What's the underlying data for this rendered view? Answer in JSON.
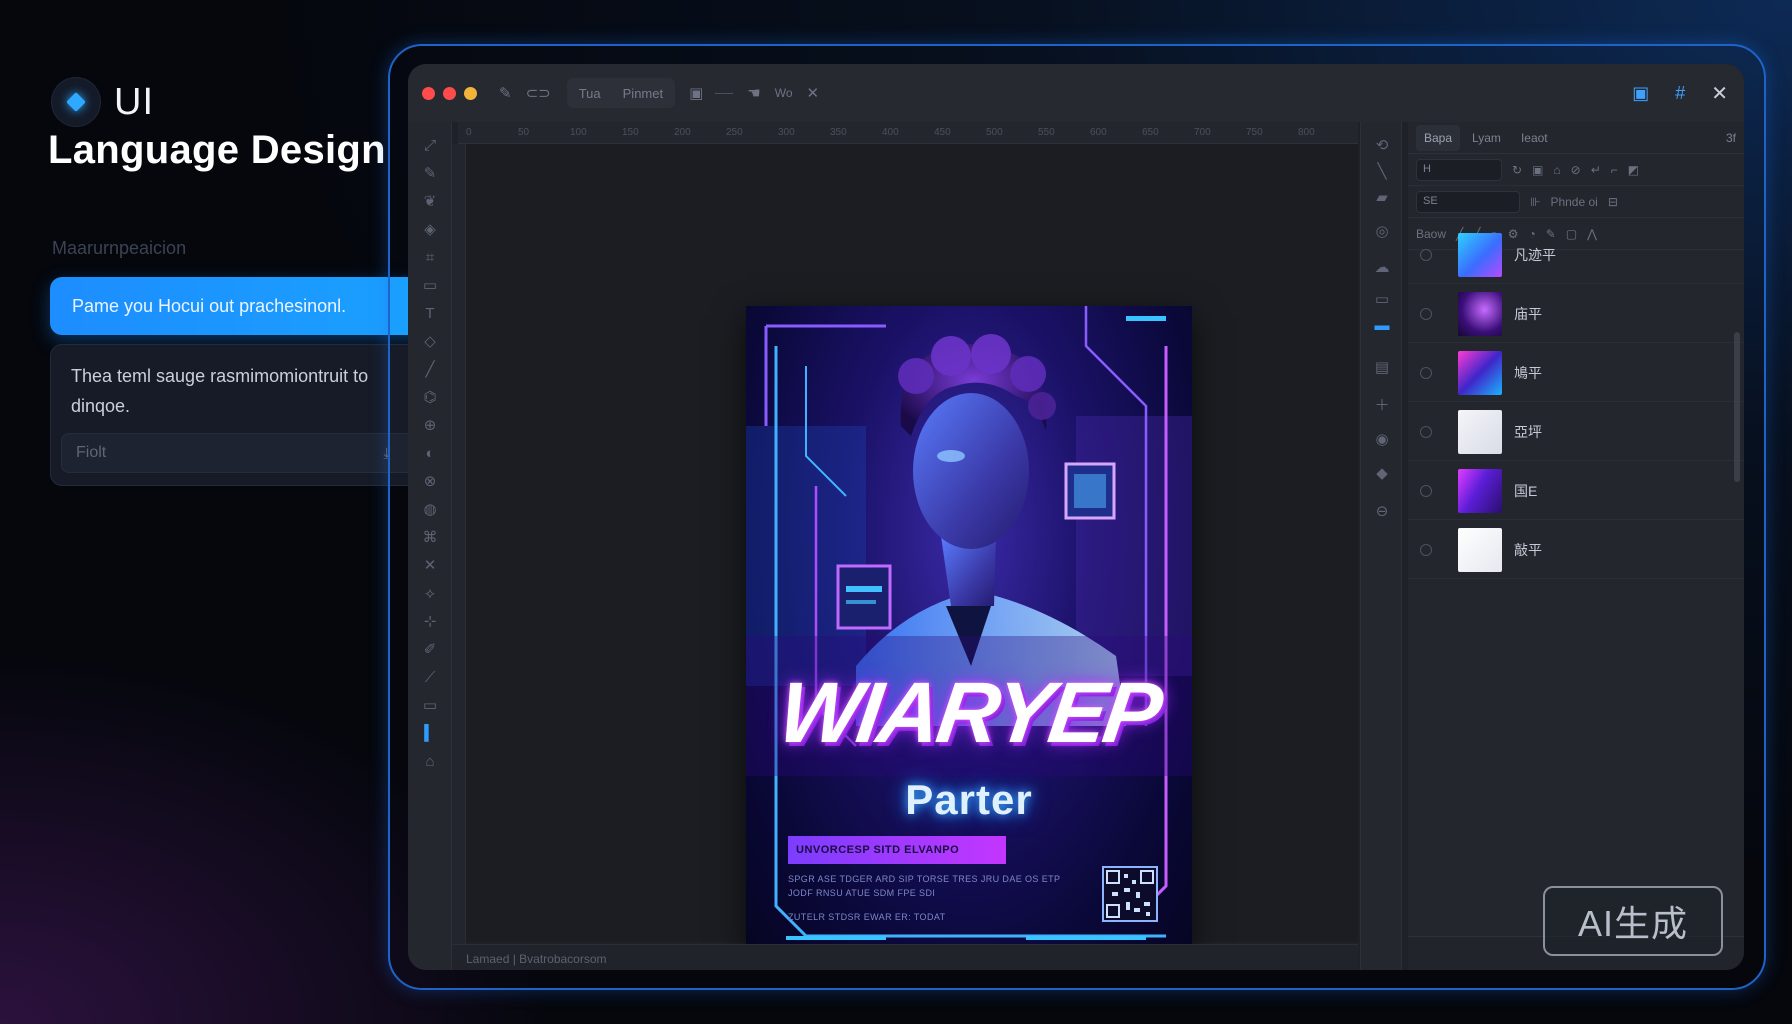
{
  "intro": {
    "brand_label": "UI",
    "headline": "Language Design",
    "section_label": "Maarurnpeaicion",
    "prompt_text": "Pame you Hocui out prachesinonl.",
    "reply_text": "Thea teml sauge rasmimomiontruit to dinqoe.",
    "reply_placeholder": "Fiolt",
    "reply_dot": "•"
  },
  "titlebar": {
    "group_items": [
      "Tua",
      "Pinmet"
    ],
    "extra_label": "Wo"
  },
  "ruler_labels": [
    "0",
    "50",
    "100",
    "150",
    "200",
    "250",
    "300",
    "350",
    "400",
    "450",
    "500",
    "550",
    "600",
    "650",
    "700",
    "750",
    "800"
  ],
  "statusbar": {
    "text": "Lamaed  |  Bvatrobacorsom"
  },
  "poster": {
    "title": "WIARYEP",
    "subtitle": "Parter",
    "band_text": "UNVORCESP SITD ELVANPO",
    "fine_line_1": "SPGR ASE TDGER ARD SIP TORSE TRES JRU DAE OS ETP",
    "fine_line_2": "JODF RNSU ATUE SDM FPE SDI",
    "fine_line_3": "ZUTELR  STDSR  EWAR  ER: TODAT"
  },
  "layers_panel": {
    "tabs": [
      "Bapa",
      "Lyam",
      "Ieaot"
    ],
    "tab_right": "3f",
    "field1_value": "H",
    "field2_value": "SE",
    "field2_text": "Phnde oi",
    "row3_label": "Baow",
    "items": [
      {
        "name": "凡迹平",
        "thumb": "linear-gradient(135deg,#2fd0ff,#3a6cff 55%,#b64bff)"
      },
      {
        "name": "庙平",
        "thumb": "radial-gradient(circle at 60% 40%,#c66bff,#3b0f7a 60%,#14072e)"
      },
      {
        "name": "鳩平",
        "thumb": "linear-gradient(135deg,#ff3bd5,#3f26c9 50%,#1bb3ff)"
      },
      {
        "name": "亞坪",
        "thumb": "linear-gradient(135deg,#f4f5fa,#d9dce6)"
      },
      {
        "name": "国E",
        "thumb": "linear-gradient(120deg,#e43cff,#5b1ed8 45%,#2a0f6e)"
      },
      {
        "name": "敲平",
        "thumb": "linear-gradient(135deg,#ffffff,#e6e8f0)"
      }
    ]
  },
  "watermark": "AI生成",
  "colors": {
    "accent": "#2f9bff",
    "frame": "#1e64c8",
    "red": "#ff4b4b",
    "yellow": "#f2b33a"
  }
}
